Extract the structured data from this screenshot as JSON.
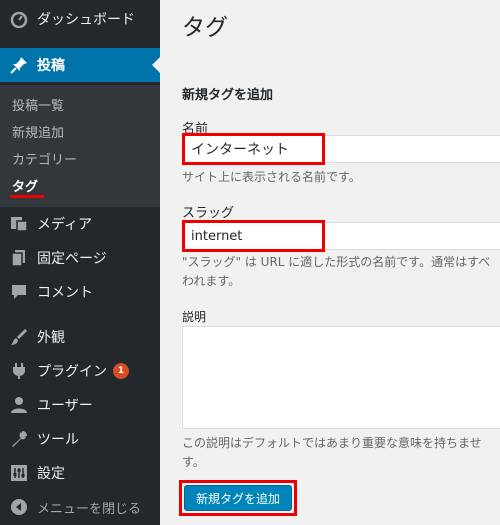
{
  "sidebar": {
    "dashboard": "ダッシュボード",
    "posts": "投稿",
    "posts_submenu": [
      "投稿一覧",
      "新規追加",
      "カテゴリー",
      "タグ"
    ],
    "media": "メディア",
    "pages": "固定ページ",
    "comments": "コメント",
    "appearance": "外観",
    "plugins": "プラグイン",
    "plugins_badge": "1",
    "users": "ユーザー",
    "tools": "ツール",
    "settings": "設定",
    "collapse": "メニューを閉じる"
  },
  "main": {
    "page_title": "タグ",
    "section_title": "新規タグを追加",
    "name_label": "名前",
    "name_value": "インターネット",
    "name_desc": "サイト上に表示される名前です。",
    "slug_label": "スラッグ",
    "slug_value": "internet",
    "slug_desc_1": "\"スラッグ\" は URL に適した形式の名前です。通常はすべ",
    "slug_desc_2": "われます。",
    "description_label": "説明",
    "description_desc_1": "この説明はデフォルトではあまり重要な意味を持ちませ",
    "description_desc_2": "す。",
    "add_button": "新規タグを追加"
  },
  "colors": {
    "sidebar_bg": "#23282d",
    "active_bg": "#0073aa",
    "highlight": "#ee0000",
    "button_bg": "#0085ba"
  }
}
